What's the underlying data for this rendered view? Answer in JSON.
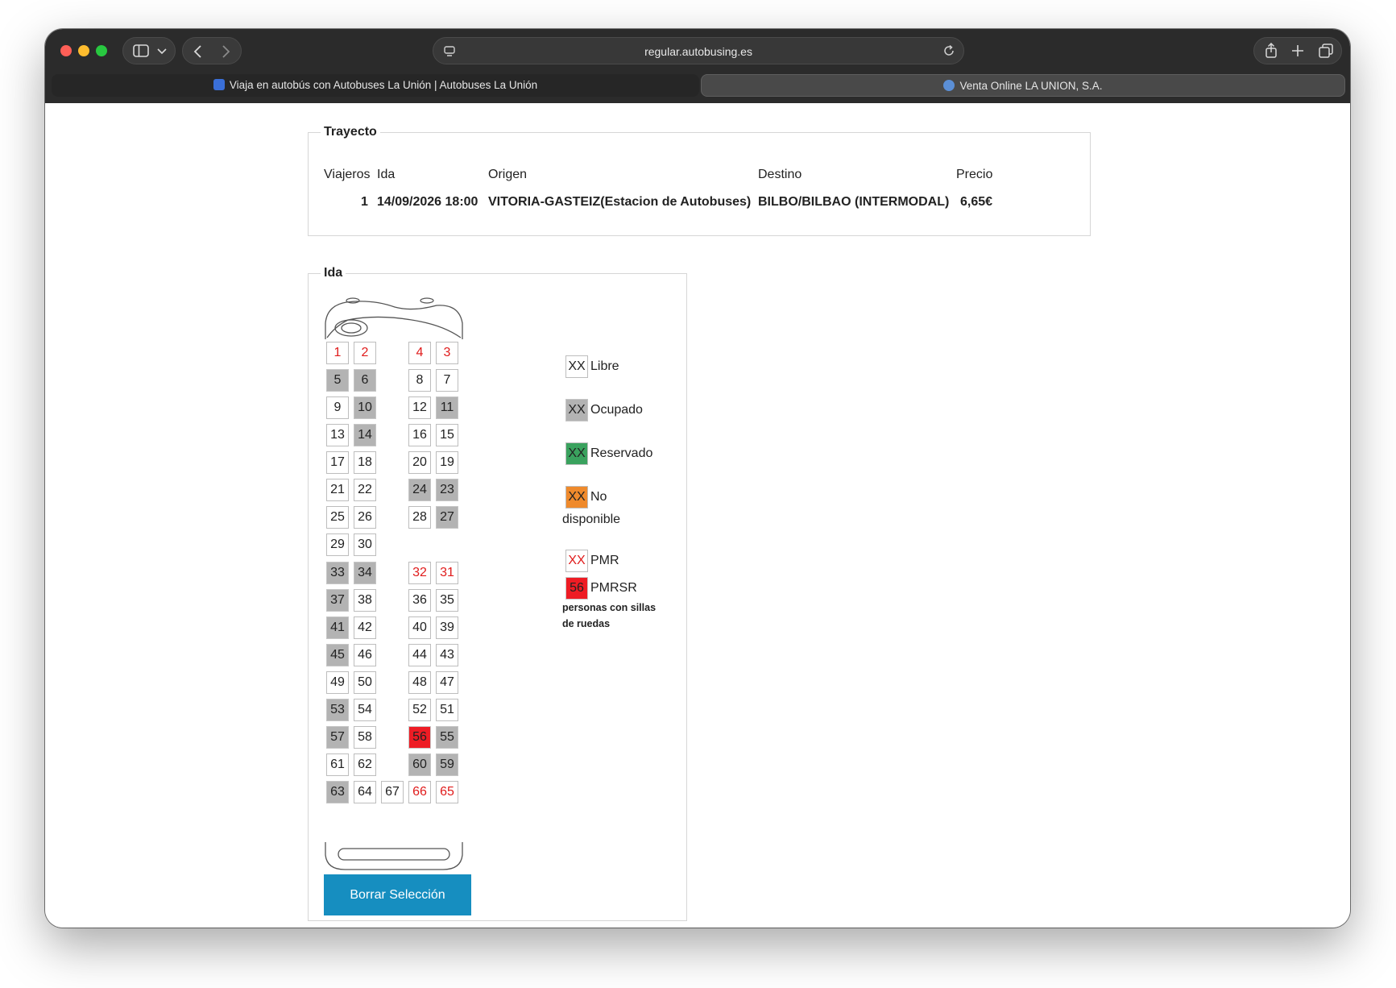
{
  "browser": {
    "url": "regular.autobusing.es",
    "tabs": [
      {
        "label": "Viaja en autobús con Autobuses La Unión | Autobuses La Unión",
        "active": false
      },
      {
        "label": "Venta Online LA UNION, S.A.",
        "active": true
      }
    ]
  },
  "trayecto": {
    "title": "Trayecto",
    "headers": {
      "viajeros": "Viajeros",
      "ida": "Ida",
      "origen": "Origen",
      "destino": "Destino",
      "precio": "Precio"
    },
    "row": {
      "viajeros": "1",
      "ida": "14/09/2026 18:00",
      "origen": "VITORIA-GASTEIZ(Estacion de Autobuses)",
      "destino": "BILBO/BILBAO (INTERMODAL)",
      "precio": "6,65€"
    }
  },
  "ida": {
    "title": "Ida",
    "seats": [
      {
        "n": "1",
        "row": 0,
        "col": 0,
        "state": "pmr"
      },
      {
        "n": "2",
        "row": 0,
        "col": 1,
        "state": "pmr"
      },
      {
        "n": "4",
        "row": 0,
        "col": 3,
        "state": "pmr"
      },
      {
        "n": "3",
        "row": 0,
        "col": 4,
        "state": "pmr"
      },
      {
        "n": "5",
        "row": 1,
        "col": 0,
        "state": "occ"
      },
      {
        "n": "6",
        "row": 1,
        "col": 1,
        "state": "occ"
      },
      {
        "n": "8",
        "row": 1,
        "col": 3,
        "state": "free"
      },
      {
        "n": "7",
        "row": 1,
        "col": 4,
        "state": "free"
      },
      {
        "n": "9",
        "row": 2,
        "col": 0,
        "state": "free"
      },
      {
        "n": "10",
        "row": 2,
        "col": 1,
        "state": "occ"
      },
      {
        "n": "12",
        "row": 2,
        "col": 3,
        "state": "free"
      },
      {
        "n": "11",
        "row": 2,
        "col": 4,
        "state": "occ"
      },
      {
        "n": "13",
        "row": 3,
        "col": 0,
        "state": "free"
      },
      {
        "n": "14",
        "row": 3,
        "col": 1,
        "state": "occ"
      },
      {
        "n": "16",
        "row": 3,
        "col": 3,
        "state": "free"
      },
      {
        "n": "15",
        "row": 3,
        "col": 4,
        "state": "free"
      },
      {
        "n": "17",
        "row": 4,
        "col": 0,
        "state": "free"
      },
      {
        "n": "18",
        "row": 4,
        "col": 1,
        "state": "free"
      },
      {
        "n": "20",
        "row": 4,
        "col": 3,
        "state": "free"
      },
      {
        "n": "19",
        "row": 4,
        "col": 4,
        "state": "free"
      },
      {
        "n": "21",
        "row": 5,
        "col": 0,
        "state": "free"
      },
      {
        "n": "22",
        "row": 5,
        "col": 1,
        "state": "free"
      },
      {
        "n": "24",
        "row": 5,
        "col": 3,
        "state": "occ"
      },
      {
        "n": "23",
        "row": 5,
        "col": 4,
        "state": "occ"
      },
      {
        "n": "25",
        "row": 6,
        "col": 0,
        "state": "free"
      },
      {
        "n": "26",
        "row": 6,
        "col": 1,
        "state": "free"
      },
      {
        "n": "28",
        "row": 6,
        "col": 3,
        "state": "free"
      },
      {
        "n": "27",
        "row": 6,
        "col": 4,
        "state": "occ"
      },
      {
        "n": "29",
        "row": 7,
        "col": 0,
        "state": "free"
      },
      {
        "n": "30",
        "row": 7,
        "col": 1,
        "state": "free"
      },
      {
        "n": "33",
        "row": 8,
        "col": 0,
        "state": "occ"
      },
      {
        "n": "34",
        "row": 8,
        "col": 1,
        "state": "occ"
      },
      {
        "n": "32",
        "row": 8,
        "col": 3,
        "state": "pmr"
      },
      {
        "n": "31",
        "row": 8,
        "col": 4,
        "state": "pmr"
      },
      {
        "n": "37",
        "row": 9,
        "col": 0,
        "state": "occ"
      },
      {
        "n": "38",
        "row": 9,
        "col": 1,
        "state": "free"
      },
      {
        "n": "36",
        "row": 9,
        "col": 3,
        "state": "free"
      },
      {
        "n": "35",
        "row": 9,
        "col": 4,
        "state": "free"
      },
      {
        "n": "41",
        "row": 10,
        "col": 0,
        "state": "occ"
      },
      {
        "n": "42",
        "row": 10,
        "col": 1,
        "state": "free"
      },
      {
        "n": "40",
        "row": 10,
        "col": 3,
        "state": "free"
      },
      {
        "n": "39",
        "row": 10,
        "col": 4,
        "state": "free"
      },
      {
        "n": "45",
        "row": 11,
        "col": 0,
        "state": "occ"
      },
      {
        "n": "46",
        "row": 11,
        "col": 1,
        "state": "free"
      },
      {
        "n": "44",
        "row": 11,
        "col": 3,
        "state": "free"
      },
      {
        "n": "43",
        "row": 11,
        "col": 4,
        "state": "free"
      },
      {
        "n": "49",
        "row": 12,
        "col": 0,
        "state": "free"
      },
      {
        "n": "50",
        "row": 12,
        "col": 1,
        "state": "free"
      },
      {
        "n": "48",
        "row": 12,
        "col": 3,
        "state": "free"
      },
      {
        "n": "47",
        "row": 12,
        "col": 4,
        "state": "free"
      },
      {
        "n": "53",
        "row": 13,
        "col": 0,
        "state": "occ"
      },
      {
        "n": "54",
        "row": 13,
        "col": 1,
        "state": "free"
      },
      {
        "n": "52",
        "row": 13,
        "col": 3,
        "state": "free"
      },
      {
        "n": "51",
        "row": 13,
        "col": 4,
        "state": "free"
      },
      {
        "n": "57",
        "row": 14,
        "col": 0,
        "state": "occ"
      },
      {
        "n": "58",
        "row": 14,
        "col": 1,
        "state": "free"
      },
      {
        "n": "56",
        "row": 14,
        "col": 3,
        "state": "pmrsr"
      },
      {
        "n": "55",
        "row": 14,
        "col": 4,
        "state": "occ"
      },
      {
        "n": "61",
        "row": 15,
        "col": 0,
        "state": "free"
      },
      {
        "n": "62",
        "row": 15,
        "col": 1,
        "state": "free"
      },
      {
        "n": "60",
        "row": 15,
        "col": 3,
        "state": "occ"
      },
      {
        "n": "59",
        "row": 15,
        "col": 4,
        "state": "occ"
      },
      {
        "n": "63",
        "row": 16,
        "col": 0,
        "state": "occ"
      },
      {
        "n": "64",
        "row": 16,
        "col": 1,
        "state": "free"
      },
      {
        "n": "67",
        "row": 16,
        "col": 2,
        "state": "free"
      },
      {
        "n": "66",
        "row": 16,
        "col": 3,
        "state": "pmr"
      },
      {
        "n": "65",
        "row": 16,
        "col": 4,
        "state": "pmr"
      }
    ],
    "legend": {
      "libre": {
        "sample": "XX",
        "label": "Libre"
      },
      "ocupado": {
        "sample": "XX",
        "label": "Ocupado",
        "color": "#b3b3b3"
      },
      "reservado": {
        "sample": "XX",
        "label": "Reservado",
        "color": "#3aa25e"
      },
      "no_disponible": {
        "sample": "XX",
        "label": "No",
        "label2": "disponible",
        "color": "#ef8a2c"
      },
      "pmr": {
        "sample": "XX",
        "label": "PMR",
        "color": "#e01b1b"
      },
      "pmrsr": {
        "sample": "56",
        "label": "PMRSR",
        "color": "#ee1c24"
      },
      "note_line1": "personas con sillas",
      "note_line2": "de ruedas"
    },
    "clear_button": "Borrar Selección"
  },
  "colors": {
    "accent_button": "#168ec0",
    "toolbar": "#2b2b2b"
  }
}
